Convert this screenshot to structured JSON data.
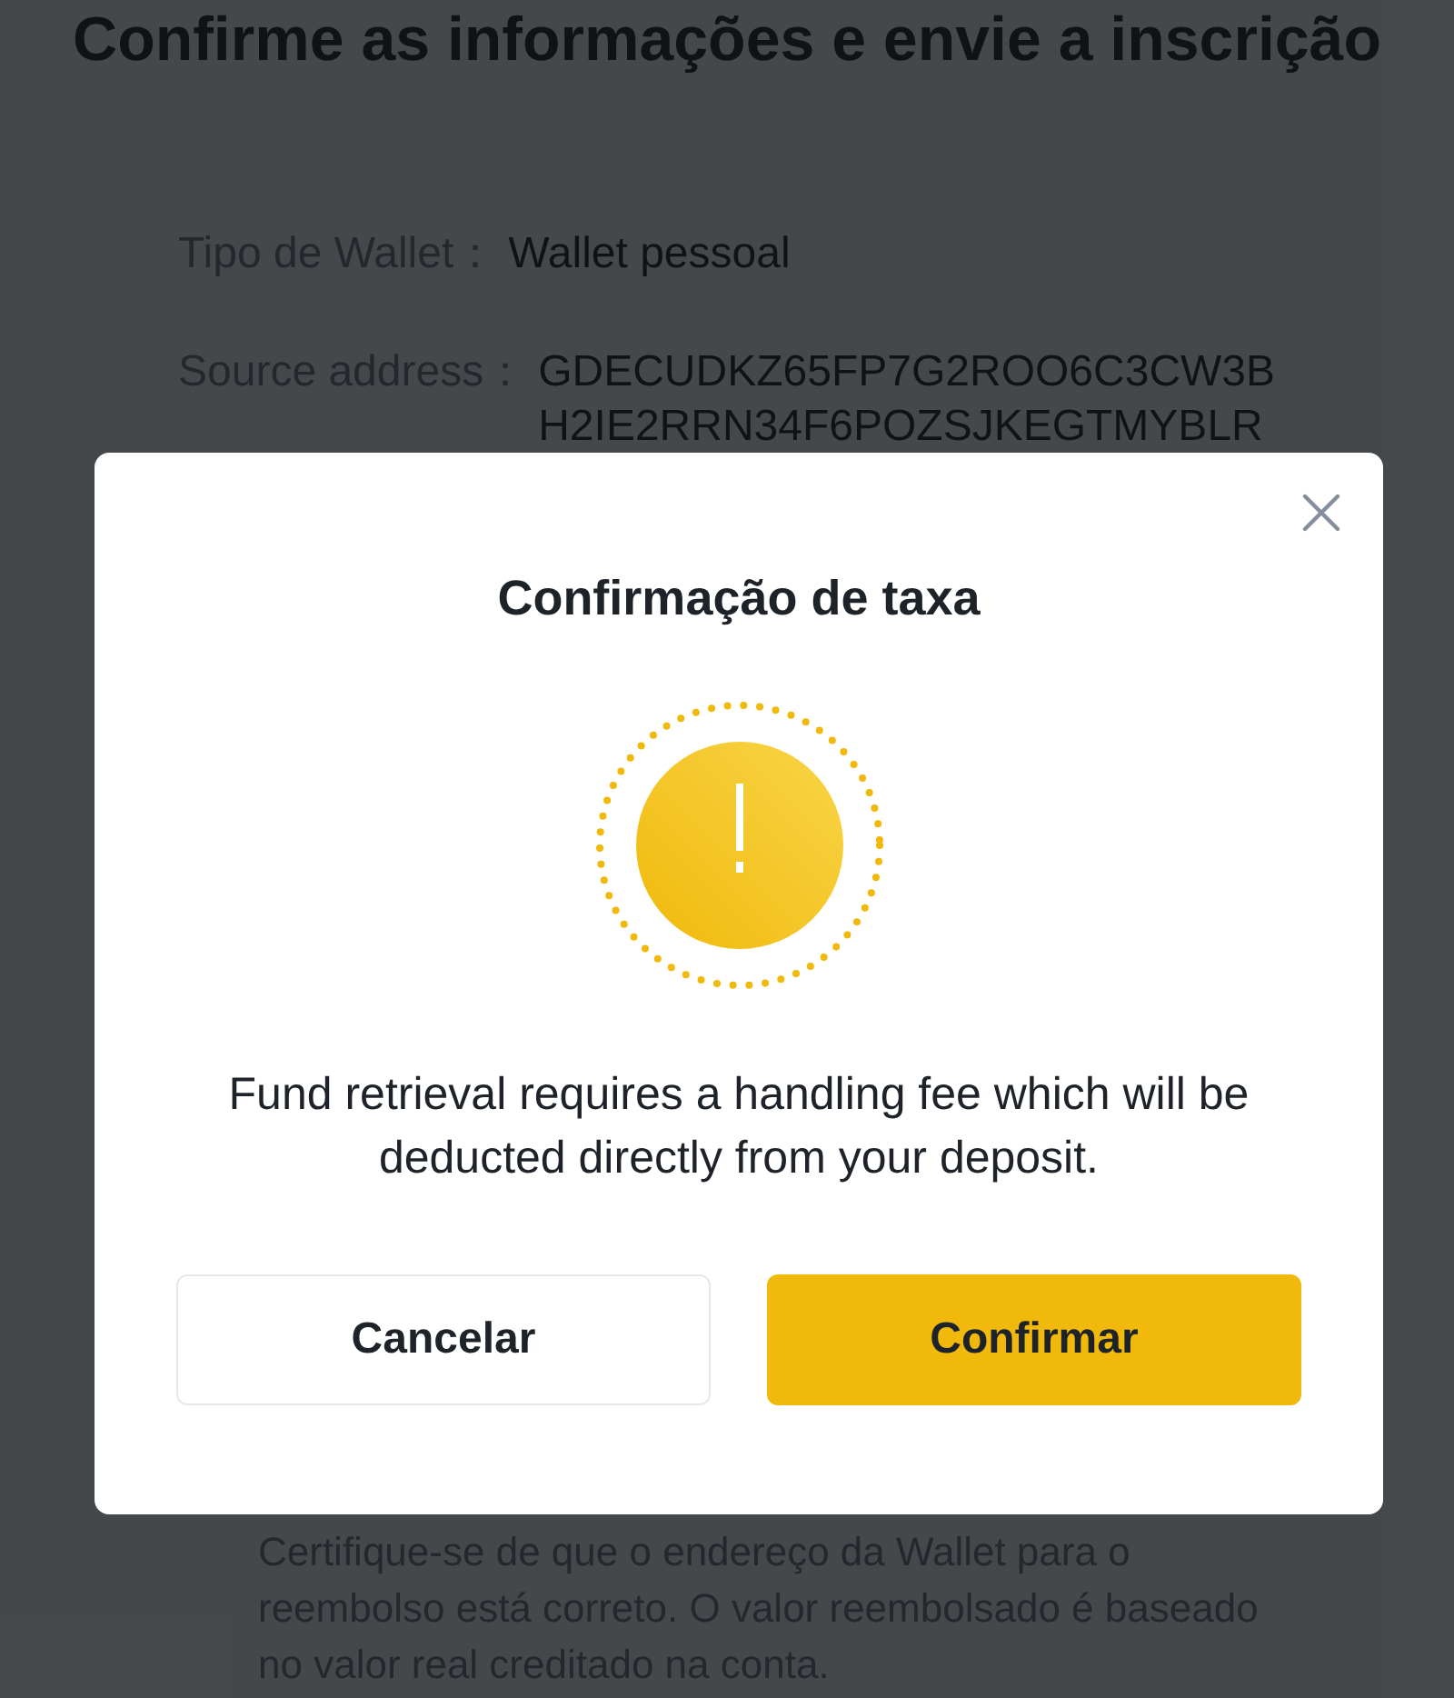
{
  "page": {
    "title": "Confirme as informações e envie a inscrição",
    "fields": [
      {
        "label": "Tipo de Wallet：",
        "value_lines": [
          "Wallet pessoal"
        ]
      },
      {
        "label": "Source address：",
        "value_lines": [
          "GDECUDKZ65FP7G2ROO6C3CW3B",
          "H2IE2RRN34F6POZSJKEGTMYBLR"
        ]
      }
    ],
    "note": "Certifique-se de que o endereço da Wallet para o reembolso está correto. O valor reembolsado é baseado no valor real creditado na conta."
  },
  "dialog": {
    "title": "Confirmação de taxa",
    "message": "Fund retrieval requires a handling fee which will be deducted directly from your deposit.",
    "buttons": [
      {
        "label": "Cancelar",
        "kind": "secondary"
      },
      {
        "label": "Confirmar",
        "kind": "primary"
      }
    ]
  }
}
